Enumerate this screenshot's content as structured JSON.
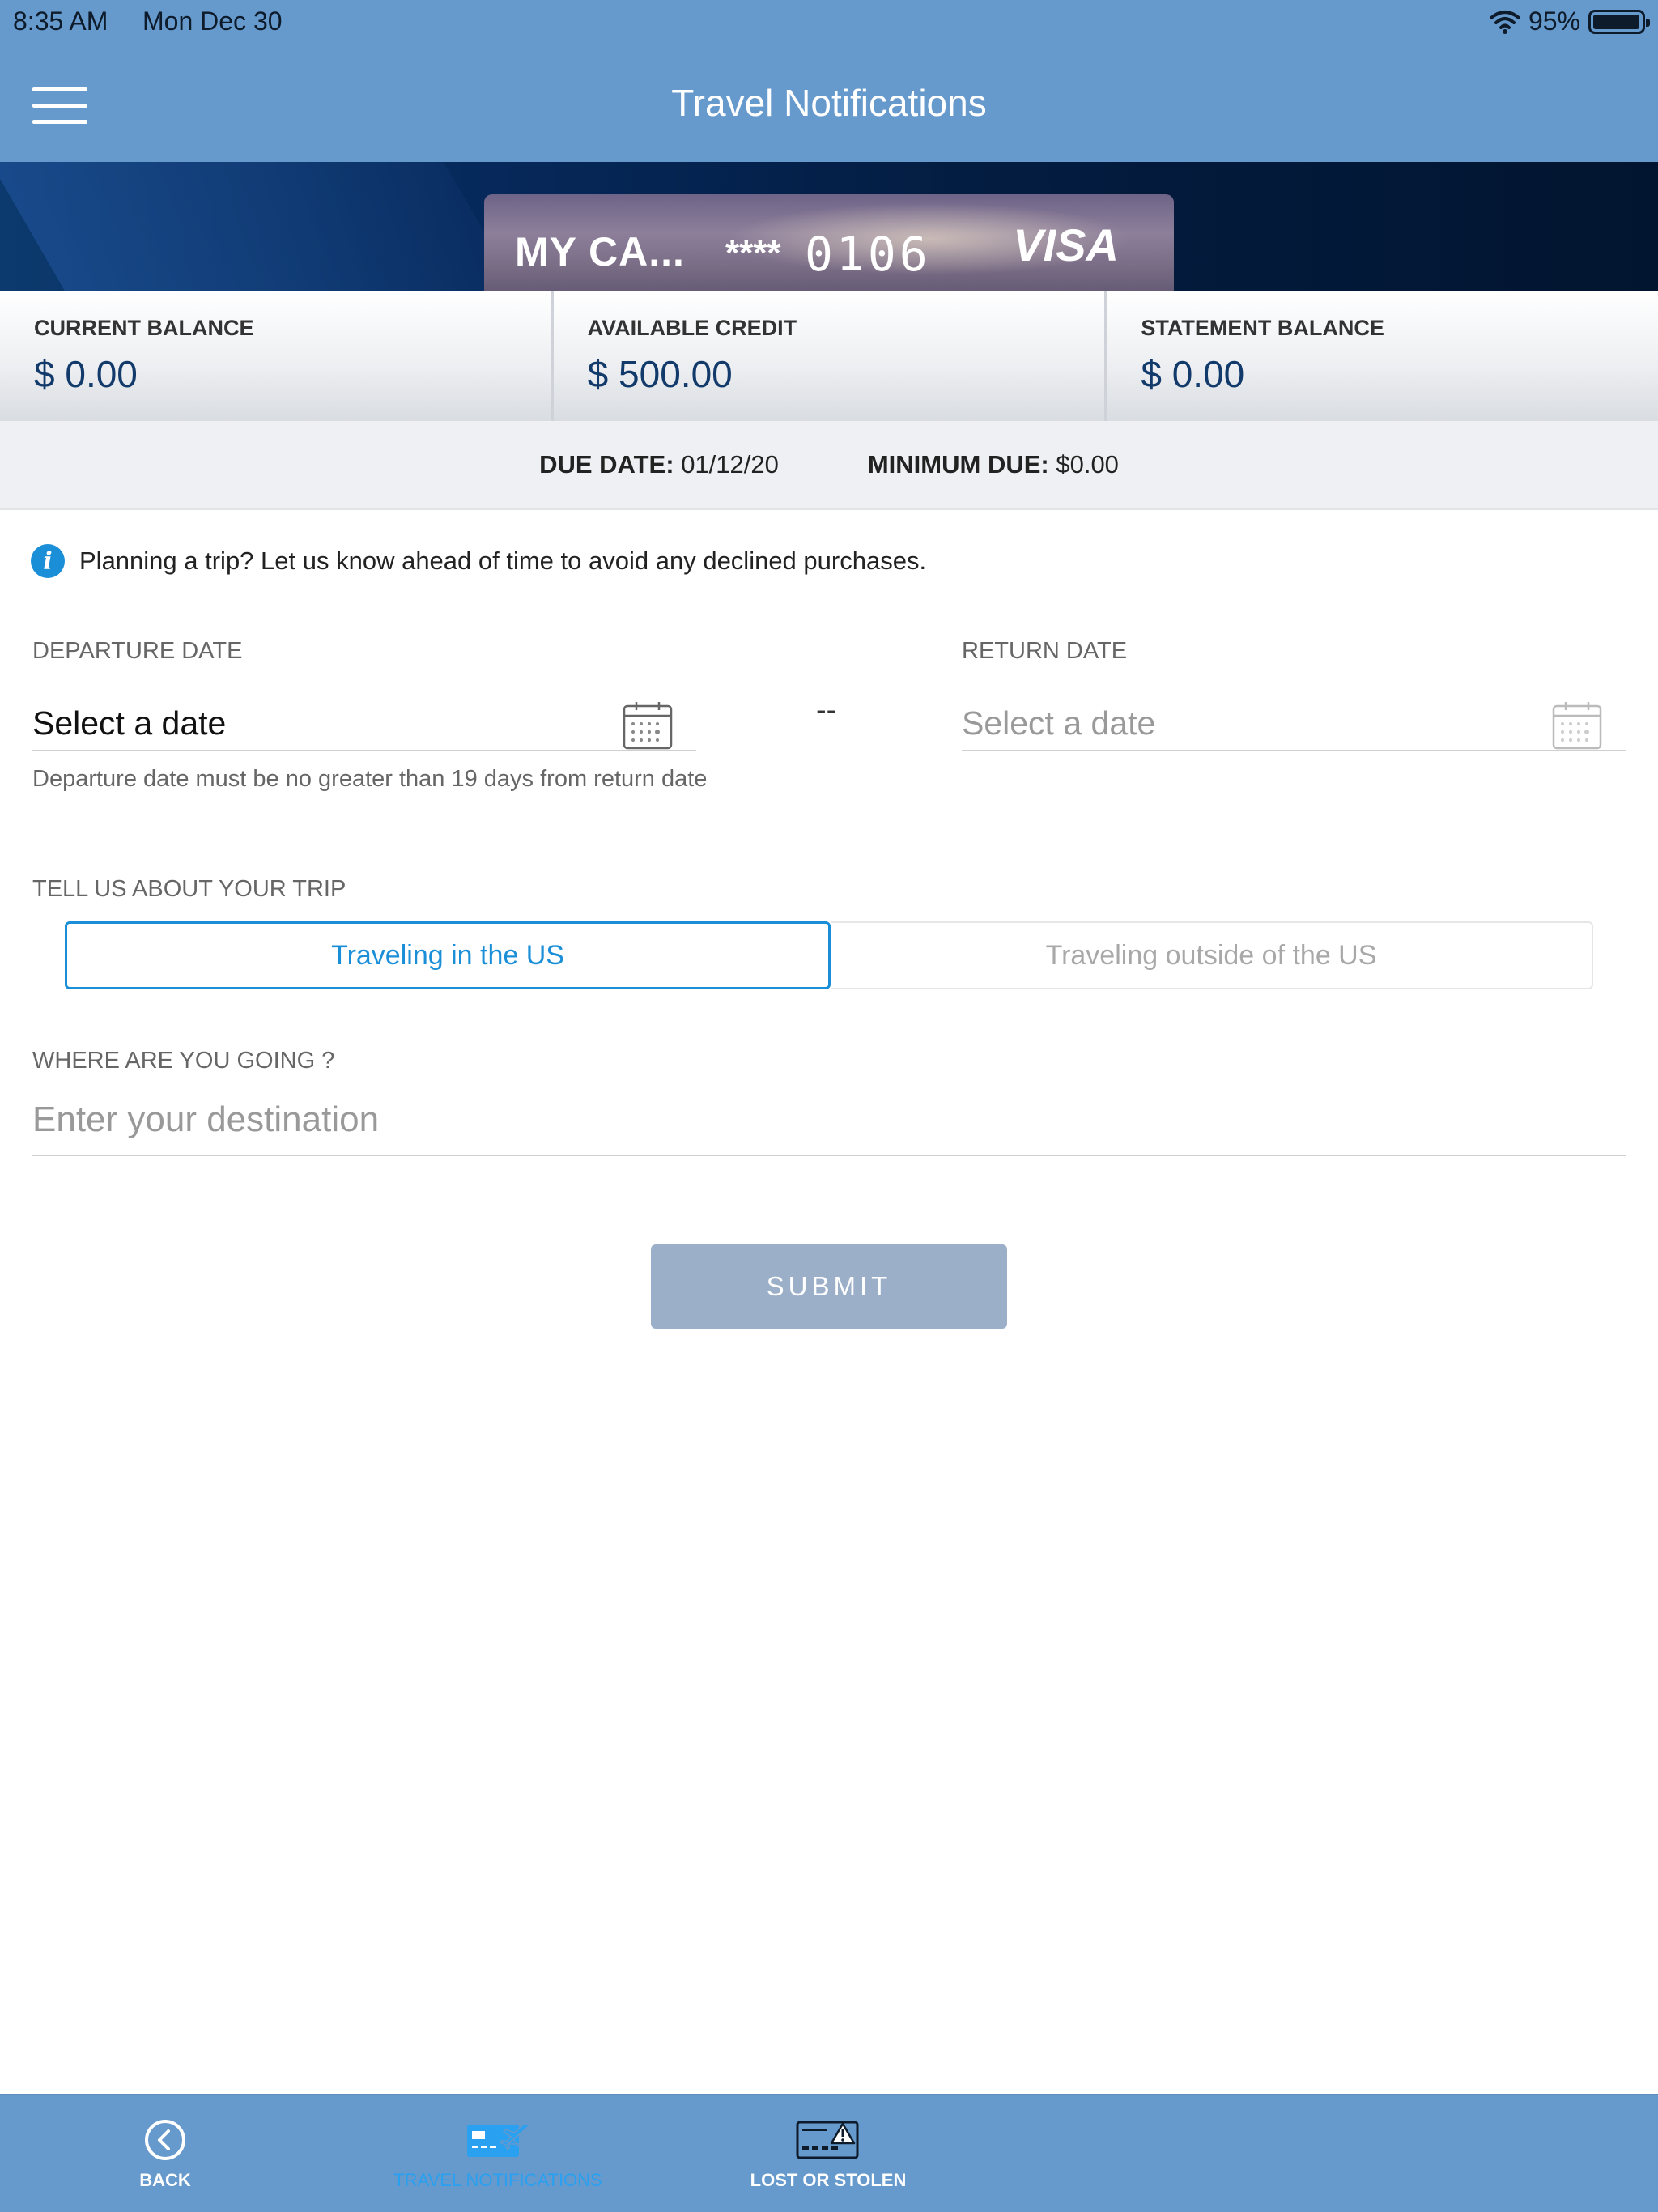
{
  "status": {
    "time": "8:35 AM",
    "date": "Mon Dec 30",
    "battery": "95%"
  },
  "header": {
    "title": "Travel Notifications"
  },
  "card": {
    "name": "MY CA...",
    "mask": "****",
    "last4": "0106",
    "brand": "VISA"
  },
  "balances": [
    {
      "label": "CURRENT BALANCE",
      "value": "$ 0.00"
    },
    {
      "label": "AVAILABLE CREDIT",
      "value": "$ 500.00"
    },
    {
      "label": "STATEMENT BALANCE",
      "value": "$ 0.00"
    }
  ],
  "due": {
    "date_label": "DUE DATE:",
    "date_value": "01/12/20",
    "min_label": "MINIMUM DUE:",
    "min_value": "$0.00"
  },
  "info_text": "Planning a trip? Let us know ahead of time to avoid any declined purchases.",
  "departure": {
    "label": "DEPARTURE DATE",
    "value": "Select a date"
  },
  "return": {
    "label": "RETURN DATE",
    "value": "Select a date"
  },
  "separator": "--",
  "hint": "Departure date must be no greater than 19 days from return date",
  "trip": {
    "label": "TELL US ABOUT YOUR TRIP",
    "option_us": "Traveling in the US",
    "option_outside": "Traveling outside of the US"
  },
  "destination": {
    "label": "WHERE ARE YOU GOING ?",
    "placeholder": "Enter your destination"
  },
  "submit_label": "SUBMIT",
  "tabs": [
    {
      "label": "BACK",
      "icon": "back-icon"
    },
    {
      "label": "TRAVEL NOTIFICATIONS",
      "icon": "card-plane-icon",
      "active": true
    },
    {
      "label": "LOST OR STOLEN",
      "icon": "card-warning-icon"
    }
  ],
  "colors": {
    "header": "#6699cc",
    "accent": "#1a8fd8",
    "navy": "#123a6b",
    "submit": "#9bb0c8"
  }
}
